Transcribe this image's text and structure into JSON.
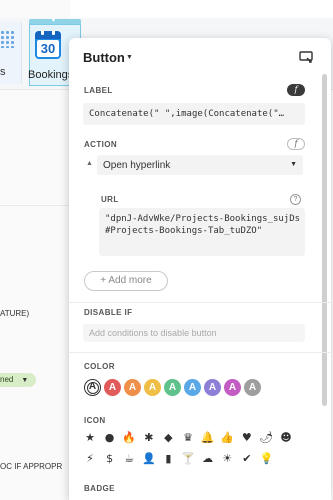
{
  "background": {
    "tiles": [
      {
        "label": "s"
      },
      {
        "label": "Bookings",
        "calendar_day": "30"
      }
    ],
    "texts": [
      {
        "text": "ATURE)"
      },
      {
        "text": "OC IF APPROPR"
      }
    ],
    "badge": {
      "label": "ned"
    }
  },
  "panel": {
    "title": "Button",
    "label_section": {
      "heading": "LABEL",
      "fx": "f",
      "value": "Concatenate(\" \",image(Concatenate(\"…"
    },
    "action_section": {
      "heading": "ACTION",
      "fx": "f",
      "selected": "Open hyperlink"
    },
    "url_section": {
      "heading": "URL",
      "help": "?",
      "value": "\"dpnJ-AdvWke/Projects-Bookings_sujDs#Projects-Bookings-Tab_tuDZO\""
    },
    "add_more_label": "+ Add more",
    "disable_section": {
      "heading": "DISABLE IF",
      "placeholder": "Add conditions to disable button"
    },
    "color_section": {
      "heading": "COLOR",
      "swatches": [
        {
          "letter": "A",
          "color": "#ffffff",
          "selected": true
        },
        {
          "letter": "A",
          "color": "#e05a5a"
        },
        {
          "letter": "A",
          "color": "#ef8f4a"
        },
        {
          "letter": "A",
          "color": "#efbe45"
        },
        {
          "letter": "A",
          "color": "#5fc28a"
        },
        {
          "letter": "A",
          "color": "#5aa9e6"
        },
        {
          "letter": "A",
          "color": "#8d7fd6"
        },
        {
          "letter": "A",
          "color": "#c25bc2"
        },
        {
          "letter": "A",
          "color": "#9e9e9e"
        }
      ]
    },
    "icon_section": {
      "heading": "ICON",
      "icons": [
        {
          "name": "star-icon",
          "glyph": "★"
        },
        {
          "name": "circle-icon",
          "glyph": "●"
        },
        {
          "name": "fire-icon",
          "glyph": "🔥"
        },
        {
          "name": "bug-icon",
          "glyph": "✱"
        },
        {
          "name": "diamond-icon",
          "glyph": "◆"
        },
        {
          "name": "trophy-icon",
          "glyph": "♛"
        },
        {
          "name": "bell-icon",
          "glyph": "🔔"
        },
        {
          "name": "thumbs-up-icon",
          "glyph": "👍"
        },
        {
          "name": "heart-icon",
          "glyph": "♥"
        },
        {
          "name": "pepper-icon",
          "glyph": "🌶"
        },
        {
          "name": "smile-icon",
          "glyph": "☻"
        },
        {
          "name": "lightning-icon",
          "glyph": "⚡"
        },
        {
          "name": "dollar-icon",
          "glyph": "$"
        },
        {
          "name": "coffee-icon",
          "glyph": "☕"
        },
        {
          "name": "user-icon",
          "glyph": "👤"
        },
        {
          "name": "phone-icon",
          "glyph": "▮"
        },
        {
          "name": "cocktail-icon",
          "glyph": "🍸"
        },
        {
          "name": "cloud-icon",
          "glyph": "☁"
        },
        {
          "name": "sun-icon",
          "glyph": "☀"
        },
        {
          "name": "check-icon",
          "glyph": "✔"
        },
        {
          "name": "lightbulb-icon",
          "glyph": "💡"
        }
      ]
    },
    "badge_section": {
      "heading": "BADGE"
    }
  }
}
